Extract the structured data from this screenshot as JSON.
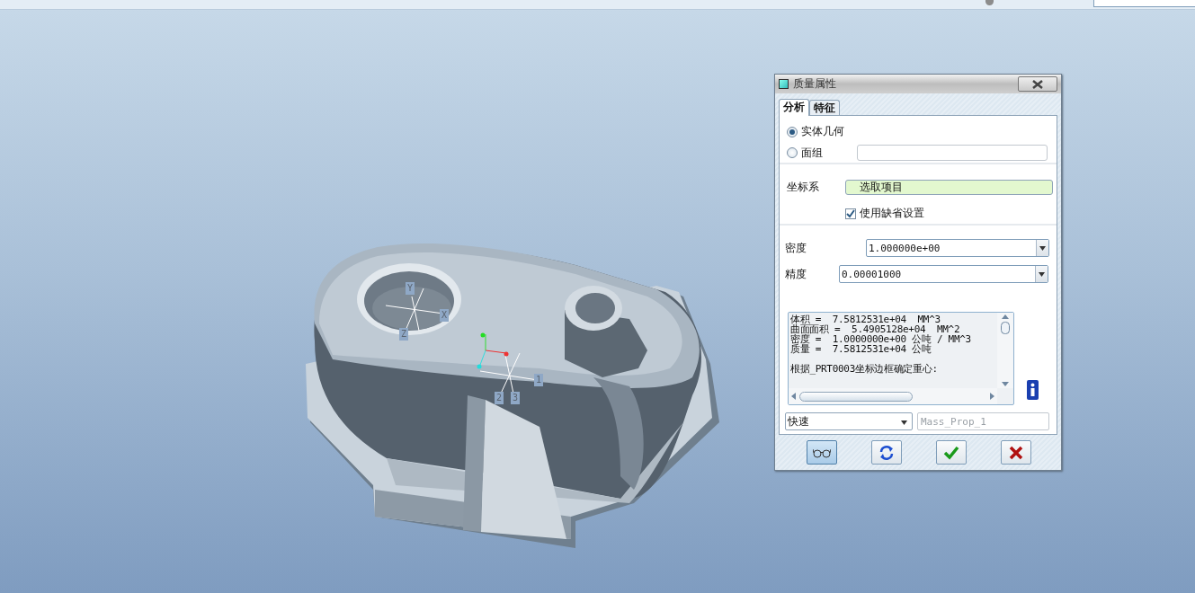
{
  "viewport": {
    "axis_labels": [
      {
        "text": "Y",
        "kind": "hole"
      },
      {
        "text": "X",
        "kind": "hole"
      },
      {
        "text": "Z",
        "kind": "hole"
      },
      {
        "text": "1",
        "kind": "center"
      },
      {
        "text": "2",
        "kind": "center"
      },
      {
        "text": "3",
        "kind": "center"
      }
    ]
  },
  "dialog": {
    "title": "质量属性",
    "tabs": [
      {
        "label": "分析",
        "selected": true
      },
      {
        "label": "特征",
        "selected": false
      }
    ],
    "geometry_options": [
      {
        "label": "实体几何",
        "selected": true
      },
      {
        "label": "面组",
        "selected": false
      }
    ],
    "coordinate_system": {
      "label": "坐标系",
      "collector": "选取项目",
      "use_default": {
        "label": "使用缺省设置",
        "checked": true
      }
    },
    "density": {
      "label": "密度",
      "value": "1.000000e+00"
    },
    "accuracy": {
      "label": "精度",
      "value": "0.00001000"
    },
    "results": [
      {
        "lines": [
          "体积 =  7.5812531e+04  MM^3",
          "曲面面积 =  5.4905128e+04  MM^2",
          "密度 =  1.0000000e+00 公吨 / MM^3",
          "质量 =  7.5812531e+04 公吨"
        ]
      },
      {
        "lines": [
          "根据_PRT0003坐标边框确定重心:"
        ]
      }
    ],
    "mode": {
      "value": "快速"
    },
    "feature_name": {
      "placeholder": "Mass_Prop_1"
    },
    "buttons": [
      {
        "kind": "preview",
        "pressed": true
      },
      {
        "kind": "repeat",
        "pressed": false
      },
      {
        "kind": "ok",
        "pressed": false
      },
      {
        "kind": "cancel",
        "pressed": false
      }
    ]
  }
}
